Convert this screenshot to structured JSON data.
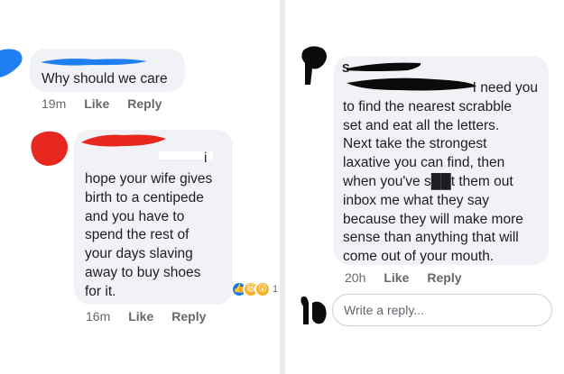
{
  "left": {
    "comment1": {
      "text": "Why should we care",
      "time": "19m",
      "like": "Like",
      "reply": "Reply"
    },
    "comment2": {
      "lines": [
        "hope your wife gives",
        "birth to a centipede",
        "and you have to",
        "spend the rest of",
        "your days slaving",
        "away to buy shoes",
        "for it."
      ],
      "partial_name_end": "i",
      "time": "16m",
      "like": "Like",
      "reply": "Reply",
      "reaction_count": "1"
    }
  },
  "right": {
    "comment": {
      "name_initial": "S",
      "lines": [
        "I need you",
        "to find the nearest scrabble",
        "set and eat all the letters.",
        "Next take the strongest",
        "laxative you can find, then",
        "when you've s██t them out",
        "inbox me what they say",
        "because they will make more",
        "sense than anything that will",
        "come out of your mouth."
      ],
      "time": "20h",
      "like": "Like",
      "reply": "Reply"
    },
    "reply_box": {
      "placeholder": "Write a reply..."
    }
  },
  "colors": {
    "blue_scribble": "#1f7ef0",
    "red_scribble": "#e8281e",
    "black_scribble": "#0b0b0b",
    "bubble": "#f0f2f5",
    "meta": "#65676b"
  },
  "icons": {
    "reaction_like": "like-icon",
    "reaction_haha": "haha-icon",
    "reaction_wow": "wow-icon"
  }
}
